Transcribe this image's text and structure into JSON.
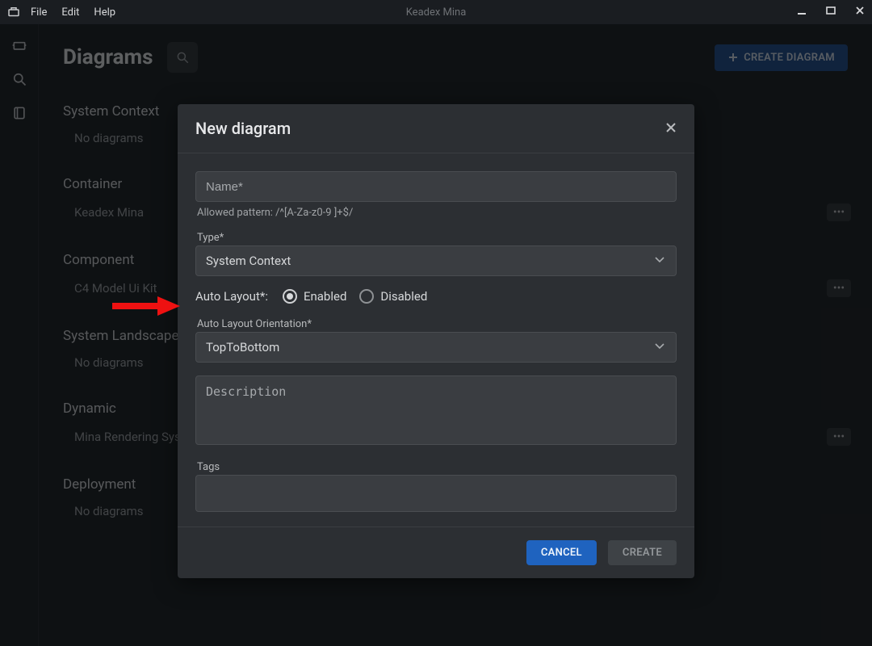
{
  "titlebar": {
    "menu": {
      "file": "File",
      "edit": "Edit",
      "help": "Help"
    },
    "app_name": "Keadex Mina"
  },
  "header": {
    "title": "Diagrams",
    "create_button": "CREATE DIAGRAM"
  },
  "sections": [
    {
      "title": "System Context",
      "items": [
        {
          "label": "No diagrams",
          "has_menu": false
        }
      ]
    },
    {
      "title": "Container",
      "items": [
        {
          "label": "Keadex Mina",
          "has_menu": true
        }
      ]
    },
    {
      "title": "Component",
      "items": [
        {
          "label": "C4 Model Ui Kit",
          "has_menu": true
        }
      ]
    },
    {
      "title": "System Landscape",
      "items": [
        {
          "label": "No diagrams",
          "has_menu": false
        }
      ]
    },
    {
      "title": "Dynamic",
      "items": [
        {
          "label": "Mina Rendering System",
          "has_menu": true
        }
      ]
    },
    {
      "title": "Deployment",
      "items": [
        {
          "label": "No diagrams",
          "has_menu": false
        }
      ]
    }
  ],
  "modal": {
    "title": "New diagram",
    "name_placeholder": "Name*",
    "name_helper": "Allowed pattern: /^[A-Za-z0-9 ]+$/",
    "type_label": "Type*",
    "type_value": "System Context",
    "auto_layout_label": "Auto Layout*:",
    "auto_layout_options": {
      "enabled": "Enabled",
      "disabled": "Disabled"
    },
    "auto_layout_selected": "enabled",
    "orientation_label": "Auto Layout Orientation*",
    "orientation_value": "TopToBottom",
    "description_placeholder": "Description",
    "tags_label": "Tags",
    "cancel": "CANCEL",
    "create": "CREATE"
  }
}
